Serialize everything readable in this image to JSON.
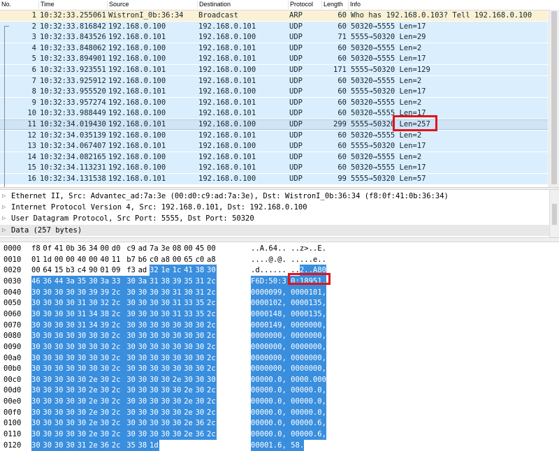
{
  "columns": [
    "No.",
    "Time",
    "Source",
    "Destination",
    "Protocol",
    "Length",
    "Info"
  ],
  "packets": [
    {
      "no": "1",
      "time": "10:32:33.255061",
      "src": "WistronI_0b:36:34",
      "dst": "Broadcast",
      "proto": "ARP",
      "len": "60",
      "info": "Who has 192.168.0.103? Tell 192.168.0.100"
    },
    {
      "no": "2",
      "time": "10:32:33.816842",
      "src": "192.168.0.100",
      "dst": "192.168.0.101",
      "proto": "UDP",
      "len": "60",
      "info": "50320→5555 Len=17"
    },
    {
      "no": "3",
      "time": "10:32:33.843526",
      "src": "192.168.0.101",
      "dst": "192.168.0.100",
      "proto": "UDP",
      "len": "71",
      "info": "5555→50320 Len=29"
    },
    {
      "no": "4",
      "time": "10:32:33.848062",
      "src": "192.168.0.100",
      "dst": "192.168.0.101",
      "proto": "UDP",
      "len": "60",
      "info": "50320→5555 Len=2"
    },
    {
      "no": "5",
      "time": "10:32:33.894901",
      "src": "192.168.0.100",
      "dst": "192.168.0.101",
      "proto": "UDP",
      "len": "60",
      "info": "50320→5555 Len=17"
    },
    {
      "no": "6",
      "time": "10:32:33.923551",
      "src": "192.168.0.101",
      "dst": "192.168.0.100",
      "proto": "UDP",
      "len": "171",
      "info": "5555→50320 Len=129"
    },
    {
      "no": "7",
      "time": "10:32:33.925912",
      "src": "192.168.0.100",
      "dst": "192.168.0.101",
      "proto": "UDP",
      "len": "60",
      "info": "50320→5555 Len=2"
    },
    {
      "no": "8",
      "time": "10:32:33.955520",
      "src": "192.168.0.101",
      "dst": "192.168.0.100",
      "proto": "UDP",
      "len": "60",
      "info": "5555→50320 Len=17"
    },
    {
      "no": "9",
      "time": "10:32:33.957274",
      "src": "192.168.0.100",
      "dst": "192.168.0.101",
      "proto": "UDP",
      "len": "60",
      "info": "50320→5555 Len=2"
    },
    {
      "no": "10",
      "time": "10:32:33.988449",
      "src": "192.168.0.100",
      "dst": "192.168.0.101",
      "proto": "UDP",
      "len": "60",
      "info": "50320→5555 Len=17"
    },
    {
      "no": "11",
      "time": "10:32:34.019430",
      "src": "192.168.0.101",
      "dst": "192.168.0.100",
      "proto": "UDP",
      "len": "299",
      "info": "5555→50320 Len=257"
    },
    {
      "no": "12",
      "time": "10:32:34.035139",
      "src": "192.168.0.100",
      "dst": "192.168.0.101",
      "proto": "UDP",
      "len": "60",
      "info": "50320→5555 Len=2"
    },
    {
      "no": "13",
      "time": "10:32:34.067407",
      "src": "192.168.0.101",
      "dst": "192.168.0.100",
      "proto": "UDP",
      "len": "60",
      "info": "5555→50320 Len=17"
    },
    {
      "no": "14",
      "time": "10:32:34.082165",
      "src": "192.168.0.100",
      "dst": "192.168.0.101",
      "proto": "UDP",
      "len": "60",
      "info": "50320→5555 Len=2"
    },
    {
      "no": "15",
      "time": "10:32:34.113231",
      "src": "192.168.0.100",
      "dst": "192.168.0.101",
      "proto": "UDP",
      "len": "60",
      "info": "50320→5555 Len=17"
    },
    {
      "no": "16",
      "time": "10:32:34.131538",
      "src": "192.168.0.101",
      "dst": "192.168.0.100",
      "proto": "UDP",
      "len": "99",
      "info": "5555→50320 Len=57"
    }
  ],
  "selected_packet": "11",
  "details": [
    {
      "text": "Ethernet II, Src: Advantec_ad:7a:3e (00:d0:c9:ad:7a:3e), Dst: WistronI_0b:36:34 (f8:0f:41:0b:36:34)"
    },
    {
      "text": "Internet Protocol Version 4, Src: 192.168.0.101, Dst: 192.168.0.100"
    },
    {
      "text": "User Datagram Protocol, Src Port: 5555, Dst Port: 50320"
    },
    {
      "text": "Data (257 bytes)"
    }
  ],
  "hex_rows": [
    {
      "offset": "0000",
      "bytes": [
        "f8",
        "0f",
        "41",
        "0b",
        "36",
        "34",
        "00",
        "d0",
        "c9",
        "ad",
        "7a",
        "3e",
        "08",
        "00",
        "45",
        "00"
      ],
      "ascii": "..A.64.. ..z>..E."
    },
    {
      "offset": "0010",
      "bytes": [
        "01",
        "1d",
        "00",
        "00",
        "40",
        "00",
        "40",
        "11",
        "b7",
        "b6",
        "c0",
        "a8",
        "00",
        "65",
        "c0",
        "a8"
      ],
      "ascii": "....@.@. .....e.."
    },
    {
      "offset": "0020",
      "bytes": [
        "00",
        "64",
        "15",
        "b3",
        "c4",
        "90",
        "01",
        "09",
        "f3",
        "ad",
        "32",
        "1e",
        "1c",
        "41",
        "38",
        "30"
      ],
      "ascii": ".d...... ..2..A80"
    },
    {
      "offset": "0030",
      "bytes": [
        "46",
        "36",
        "44",
        "3a",
        "35",
        "30",
        "3a",
        "33",
        "30",
        "3a",
        "31",
        "38",
        "39",
        "35",
        "31",
        "2c"
      ],
      "ascii": "F6D:50:3 0:18951,"
    },
    {
      "offset": "0040",
      "bytes": [
        "30",
        "30",
        "30",
        "30",
        "30",
        "39",
        "39",
        "2c",
        "30",
        "30",
        "30",
        "30",
        "31",
        "30",
        "31",
        "2c"
      ],
      "ascii": "0000099, 0000101,"
    },
    {
      "offset": "0050",
      "bytes": [
        "30",
        "30",
        "30",
        "30",
        "31",
        "30",
        "32",
        "2c",
        "30",
        "30",
        "30",
        "30",
        "31",
        "33",
        "35",
        "2c"
      ],
      "ascii": "0000102, 0000135,"
    },
    {
      "offset": "0060",
      "bytes": [
        "30",
        "30",
        "30",
        "30",
        "31",
        "34",
        "38",
        "2c",
        "30",
        "30",
        "30",
        "30",
        "31",
        "33",
        "35",
        "2c"
      ],
      "ascii": "0000148, 0000135,"
    },
    {
      "offset": "0070",
      "bytes": [
        "30",
        "30",
        "30",
        "30",
        "31",
        "34",
        "39",
        "2c",
        "30",
        "30",
        "30",
        "30",
        "30",
        "30",
        "30",
        "2c"
      ],
      "ascii": "0000149, 0000000,"
    },
    {
      "offset": "0080",
      "bytes": [
        "30",
        "30",
        "30",
        "30",
        "30",
        "30",
        "30",
        "2c",
        "30",
        "30",
        "30",
        "30",
        "30",
        "30",
        "30",
        "2c"
      ],
      "ascii": "0000000, 0000000,"
    },
    {
      "offset": "0090",
      "bytes": [
        "30",
        "30",
        "30",
        "30",
        "30",
        "30",
        "30",
        "2c",
        "30",
        "30",
        "30",
        "30",
        "30",
        "30",
        "30",
        "2c"
      ],
      "ascii": "0000000, 0000000,"
    },
    {
      "offset": "00a0",
      "bytes": [
        "30",
        "30",
        "30",
        "30",
        "30",
        "30",
        "30",
        "2c",
        "30",
        "30",
        "30",
        "30",
        "30",
        "30",
        "30",
        "2c"
      ],
      "ascii": "0000000, 0000000,"
    },
    {
      "offset": "00b0",
      "bytes": [
        "30",
        "30",
        "30",
        "30",
        "30",
        "30",
        "30",
        "2c",
        "30",
        "30",
        "30",
        "30",
        "30",
        "30",
        "30",
        "2c"
      ],
      "ascii": "0000000, 0000000,"
    },
    {
      "offset": "00c0",
      "bytes": [
        "30",
        "30",
        "30",
        "30",
        "30",
        "2e",
        "30",
        "2c",
        "30",
        "30",
        "30",
        "30",
        "2e",
        "30",
        "30",
        "30"
      ],
      "ascii": "00000.0, 0000.000"
    },
    {
      "offset": "00d0",
      "bytes": [
        "30",
        "30",
        "30",
        "30",
        "30",
        "2e",
        "30",
        "2c",
        "30",
        "30",
        "30",
        "30",
        "30",
        "2e",
        "30",
        "2c"
      ],
      "ascii": "00000.0, 00000.0,"
    },
    {
      "offset": "00e0",
      "bytes": [
        "30",
        "30",
        "30",
        "30",
        "30",
        "2e",
        "30",
        "2c",
        "30",
        "30",
        "30",
        "30",
        "30",
        "2e",
        "30",
        "2c"
      ],
      "ascii": "00000.0, 00000.0,"
    },
    {
      "offset": "00f0",
      "bytes": [
        "30",
        "30",
        "30",
        "30",
        "30",
        "2e",
        "30",
        "2c",
        "30",
        "30",
        "30",
        "30",
        "30",
        "2e",
        "30",
        "2c"
      ],
      "ascii": "00000.0, 00000.0,"
    },
    {
      "offset": "0100",
      "bytes": [
        "30",
        "30",
        "30",
        "30",
        "30",
        "2e",
        "30",
        "2c",
        "30",
        "30",
        "30",
        "30",
        "30",
        "2e",
        "36",
        "2c"
      ],
      "ascii": "00000.0, 00000.6,"
    },
    {
      "offset": "0110",
      "bytes": [
        "30",
        "30",
        "30",
        "30",
        "30",
        "2e",
        "30",
        "2c",
        "30",
        "30",
        "30",
        "30",
        "30",
        "2e",
        "36",
        "2c"
      ],
      "ascii": "00000.0, 00000.6,"
    },
    {
      "offset": "0120",
      "bytes": [
        "30",
        "30",
        "30",
        "30",
        "31",
        "2e",
        "36",
        "2c",
        "35",
        "38",
        "1d"
      ],
      "ascii": "00001.6, 58."
    }
  ],
  "highlight_color": "#3a8ede",
  "selected_row_color": "#fbf1d5",
  "udp_row_color": "#daeefe",
  "annotation_color": "#e0141e"
}
